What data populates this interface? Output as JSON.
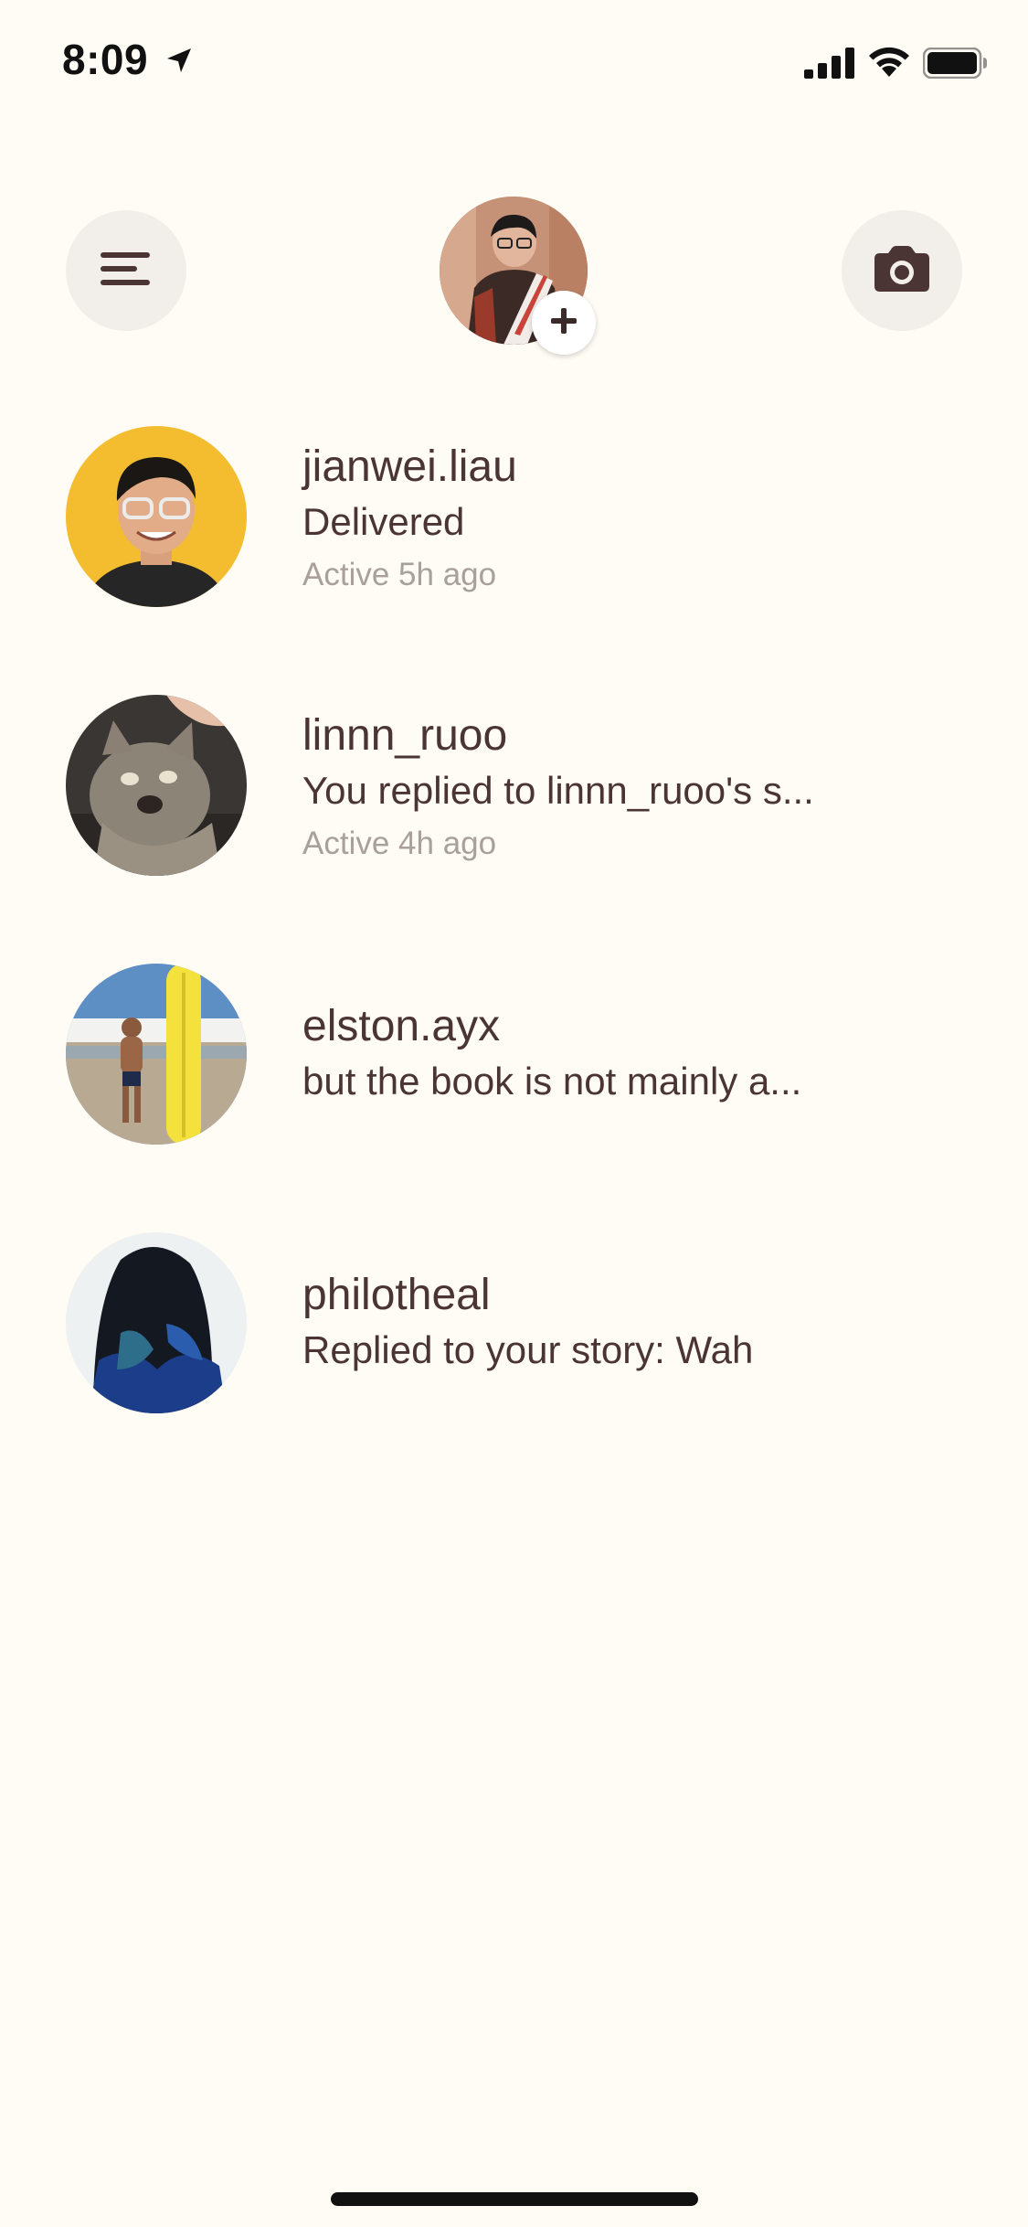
{
  "status_bar": {
    "time": "8:09",
    "icons": [
      "location-arrow-icon",
      "signal-icon",
      "wifi-icon",
      "battery-icon"
    ]
  },
  "header": {
    "menu_icon": "hamburger-menu-icon",
    "camera_icon": "camera-icon",
    "add_story_icon": "plus-icon"
  },
  "conversations": [
    {
      "username": "jianwei.liau",
      "preview": "Delivered",
      "status": "Active 5h ago"
    },
    {
      "username": "linnn_ruoo",
      "preview": "You replied to linnn_ruoo's s...",
      "status": "Active 4h ago"
    },
    {
      "username": "elston.ayx",
      "preview": "but the book is not mainly a...",
      "status": ""
    },
    {
      "username": "philotheal",
      "preview": "Replied to your story: Wah",
      "status": ""
    }
  ],
  "colors": {
    "background": "#fffbf5",
    "text_primary": "#4a3434",
    "text_secondary": "#a9a09b",
    "button_bg": "#f2eeea"
  }
}
